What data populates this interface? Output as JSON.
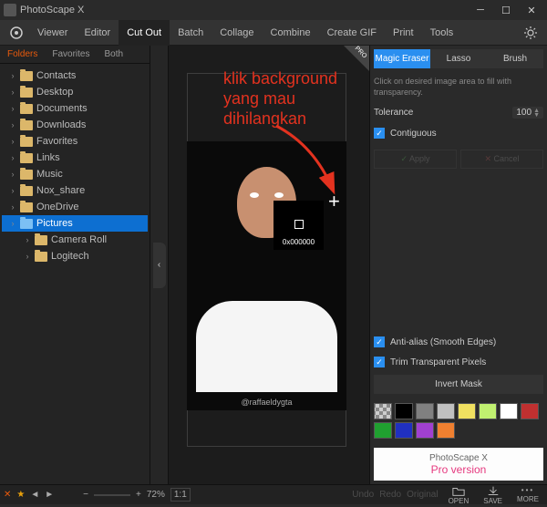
{
  "app": {
    "title": "PhotoScape X"
  },
  "toolbar": {
    "tabs": [
      "Viewer",
      "Editor",
      "Cut Out",
      "Batch",
      "Collage",
      "Combine",
      "Create GIF",
      "Print",
      "Tools"
    ],
    "active": "Cut Out"
  },
  "left": {
    "tabs": [
      "Folders",
      "Favorites",
      "Both"
    ],
    "active": "Folders",
    "items": [
      {
        "label": "Contacts"
      },
      {
        "label": "Desktop"
      },
      {
        "label": "Documents"
      },
      {
        "label": "Downloads"
      },
      {
        "label": "Favorites"
      },
      {
        "label": "Links"
      },
      {
        "label": "Music"
      },
      {
        "label": "Nox_share"
      },
      {
        "label": "OneDrive"
      },
      {
        "label": "Pictures",
        "selected": true
      },
      {
        "label": "Camera Roll",
        "child": true
      },
      {
        "label": "Logitech",
        "child": true
      }
    ]
  },
  "canvas": {
    "pro_badge": "PRO",
    "annotation_l1": "klik background",
    "annotation_l2": "yang mau",
    "annotation_l3": "dihilangkan",
    "tooltip_hex": "0x000000",
    "watermark": "@raffaeldygta"
  },
  "right": {
    "tool_tabs": [
      "Magic Eraser",
      "Lasso",
      "Brush"
    ],
    "tool_active": "Magic Eraser",
    "hint": "Click on desired image area to fill with transparency.",
    "tolerance_label": "Tolerance",
    "tolerance_value": "100",
    "contiguous": "Contiguous",
    "apply": "Apply",
    "cancel": "Cancel",
    "antialias": "Anti-alias (Smooth Edges)",
    "trim": "Trim Transparent Pixels",
    "invert": "Invert Mask",
    "swatches": [
      "checker",
      "#000000",
      "#808080",
      "#c0c0c0",
      "#f0e060",
      "#c0f070",
      "#ffffff",
      "#c03030",
      "#20a030",
      "#2030c0",
      "#a040d0",
      "#f08030"
    ],
    "pro_ad_l1": "PhotoScape X",
    "pro_ad_l2": "Pro version"
  },
  "bottom": {
    "zoom": "72%",
    "ratio": "1:1",
    "undo": "Undo",
    "redo": "Redo",
    "original": "Original",
    "open": "OPEN",
    "save": "SAVE",
    "more": "MORE"
  }
}
